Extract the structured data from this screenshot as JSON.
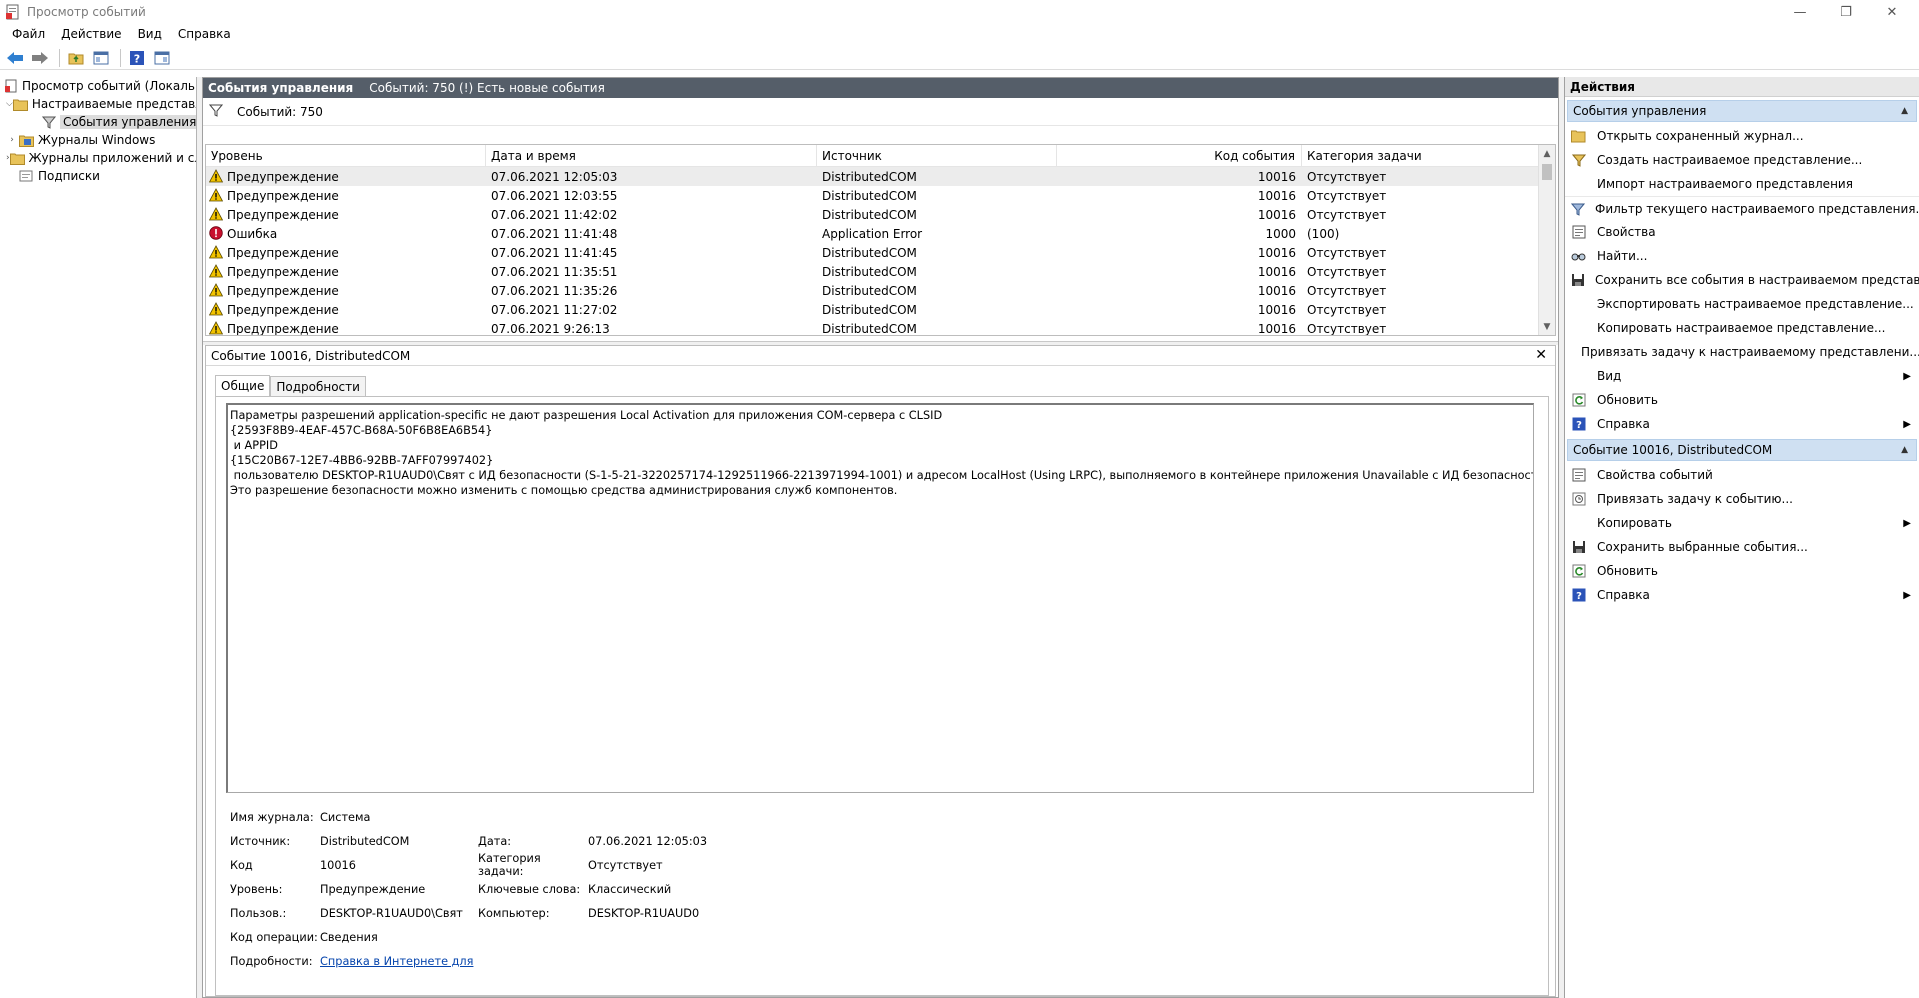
{
  "window": {
    "title": "Просмотр событий"
  },
  "menu": [
    "Файл",
    "Действие",
    "Вид",
    "Справка"
  ],
  "tree": {
    "root": "Просмотр событий (Локальный)",
    "custom_views": "Настраиваемые представления",
    "admin_events": "События управления",
    "windows_logs": "Журналы Windows",
    "app_logs": "Журналы приложений и служб",
    "subscriptions": "Подписки"
  },
  "center": {
    "header_title": "События управления",
    "header_info": "Событий: 750 (!) Есть новые события",
    "filter_label": "Событий: 750"
  },
  "grid": {
    "columns": {
      "level": "Уровень",
      "date": "Дата и время",
      "source": "Источник",
      "code": "Код события",
      "category": "Категория задачи"
    },
    "rows": [
      {
        "level": "Предупреждение",
        "type": "warning",
        "date": "07.06.2021 12:05:03",
        "source": "DistributedCOM",
        "code": "10016",
        "category": "Отсутствует"
      },
      {
        "level": "Предупреждение",
        "type": "warning",
        "date": "07.06.2021 12:03:55",
        "source": "DistributedCOM",
        "code": "10016",
        "category": "Отсутствует"
      },
      {
        "level": "Предупреждение",
        "type": "warning",
        "date": "07.06.2021 11:42:02",
        "source": "DistributedCOM",
        "code": "10016",
        "category": "Отсутствует"
      },
      {
        "level": "Ошибка",
        "type": "error",
        "date": "07.06.2021 11:41:48",
        "source": "Application Error",
        "code": "1000",
        "category": "(100)"
      },
      {
        "level": "Предупреждение",
        "type": "warning",
        "date": "07.06.2021 11:41:45",
        "source": "DistributedCOM",
        "code": "10016",
        "category": "Отсутствует"
      },
      {
        "level": "Предупреждение",
        "type": "warning",
        "date": "07.06.2021 11:35:51",
        "source": "DistributedCOM",
        "code": "10016",
        "category": "Отсутствует"
      },
      {
        "level": "Предупреждение",
        "type": "warning",
        "date": "07.06.2021 11:35:26",
        "source": "DistributedCOM",
        "code": "10016",
        "category": "Отсутствует"
      },
      {
        "level": "Предупреждение",
        "type": "warning",
        "date": "07.06.2021 11:27:02",
        "source": "DistributedCOM",
        "code": "10016",
        "category": "Отсутствует"
      },
      {
        "level": "Предупреждение",
        "type": "warning",
        "date": "07.06.2021 9:26:13",
        "source": "DistributedCOM",
        "code": "10016",
        "category": "Отсутствует"
      }
    ]
  },
  "detail": {
    "title": "Событие 10016, DistributedCOM",
    "tab_general": "Общие",
    "tab_details": "Подробности",
    "message": "Параметры разрешений application-specific не дают разрешения Local Activation для приложения COM-сервера с CLSID \n{2593F8B9-4EAF-457C-B68A-50F6B8EA6B54}\n и APPID \n{15C20B67-12E7-4BB6-92BB-7AFF07997402}\n пользователю DESKTOP-R1UAUD0\\Свят с ИД безопасности (S-1-5-21-3220257174-1292511966-2213971994-1001) и адресом LocalHost (Using LRPC), выполняемого в контейнере приложения Unavailable с ИД безопасности (Unavailable).\nЭто разрешение безопасности можно изменить с помощью средства администрирования служб компонентов.",
    "labels": {
      "log": "Имя журнала:",
      "source": "Источник:",
      "code": "Код",
      "level": "Уровень:",
      "user": "Пользов.:",
      "opcode": "Код операции:",
      "more": "Подробности:",
      "date": "Дата:",
      "category": "Категория задачи:",
      "keywords": "Ключевые слова:",
      "computer": "Компьютер:"
    },
    "values": {
      "log": "Система",
      "source": "DistributedCOM",
      "code": "10016",
      "level": "Предупреждение",
      "user": "DESKTOP-R1UAUD0\\Свят",
      "opcode": "Сведения",
      "more_link": "Справка в Интернете для",
      "date": "07.06.2021 12:05:03",
      "category": "Отсутствует",
      "keywords": "Классический",
      "computer": "DESKTOP-R1UAUD0"
    }
  },
  "actions": {
    "title": "Действия",
    "section1": "События управления",
    "items1": [
      "Открыть сохраненный журнал...",
      "Создать настраиваемое представление...",
      "Импорт настраиваемого представления",
      "Фильтр текущего настраиваемого представления...",
      "Свойства",
      "Найти...",
      "Сохранить все события в настраиваемом представл...",
      "Экспортировать настраиваемое представление...",
      "Копировать настраиваемое представление...",
      "Привязать задачу к настраиваемому представлени...",
      "Вид",
      "Обновить",
      "Справка"
    ],
    "section2": "Событие 10016, DistributedCOM",
    "items2": [
      "Свойства событий",
      "Привязать задачу к событию...",
      "Копировать",
      "Сохранить выбранные события...",
      "Обновить",
      "Справка"
    ]
  }
}
